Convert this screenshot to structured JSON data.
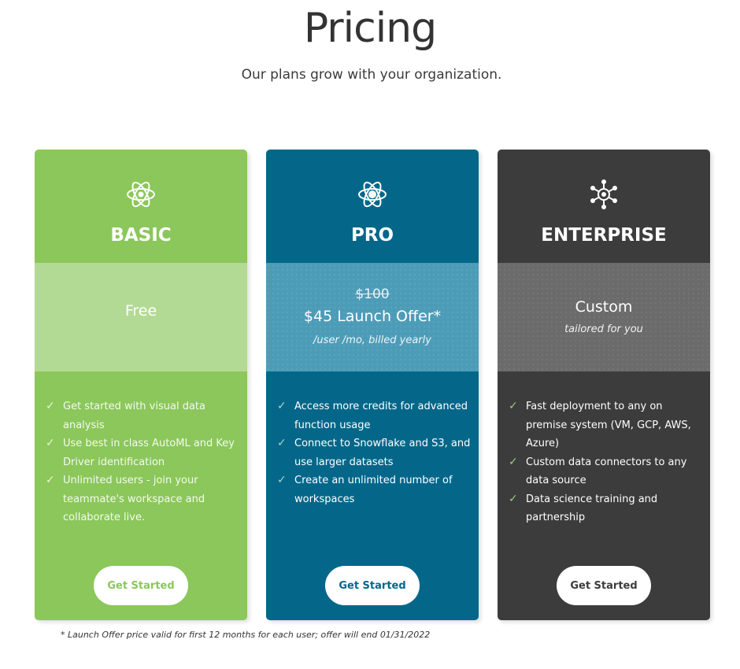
{
  "header": {
    "title": "Pricing",
    "subtitle": "Our plans grow with your organization."
  },
  "plans": [
    {
      "name": "BASIC",
      "icon": "atom-icon",
      "price": "Free",
      "features": [
        "Get started with visual data analysis",
        "Use best in class AutoML and Key Driver identification",
        "Unlimited users - join your teammate's workspace and collaborate live."
      ],
      "cta": "Get Started",
      "color": "#8bc75a",
      "band_color": "#b3da94"
    },
    {
      "name": "PRO",
      "icon": "atom-icon",
      "old_price": "$100",
      "offer": "$45 Launch Offer*",
      "period": "/user /mo, billed yearly",
      "features": [
        "Access more credits for advanced function usage",
        "Connect to Snowflake and S3, and use larger datasets",
        "Create an unlimited number of workspaces"
      ],
      "cta": "Get Started",
      "color": "#04678a",
      "band_color": "#4c9cb8"
    },
    {
      "name": "ENTERPRISE",
      "icon": "network-icon",
      "price": "Custom",
      "price_sub": "tailored for you",
      "features": [
        "Fast deployment to any on premise system (VM, GCP, AWS, Azure)",
        "Custom data connectors to any data source",
        "Data science training and partnership"
      ],
      "cta": "Get Started",
      "color": "#3c3c3c",
      "band_color": "#6b6b6b"
    }
  ],
  "footnote": "* Launch Offer price valid for first 12 months for each user; offer will end 01/31/2022",
  "check_glyph": "✓"
}
